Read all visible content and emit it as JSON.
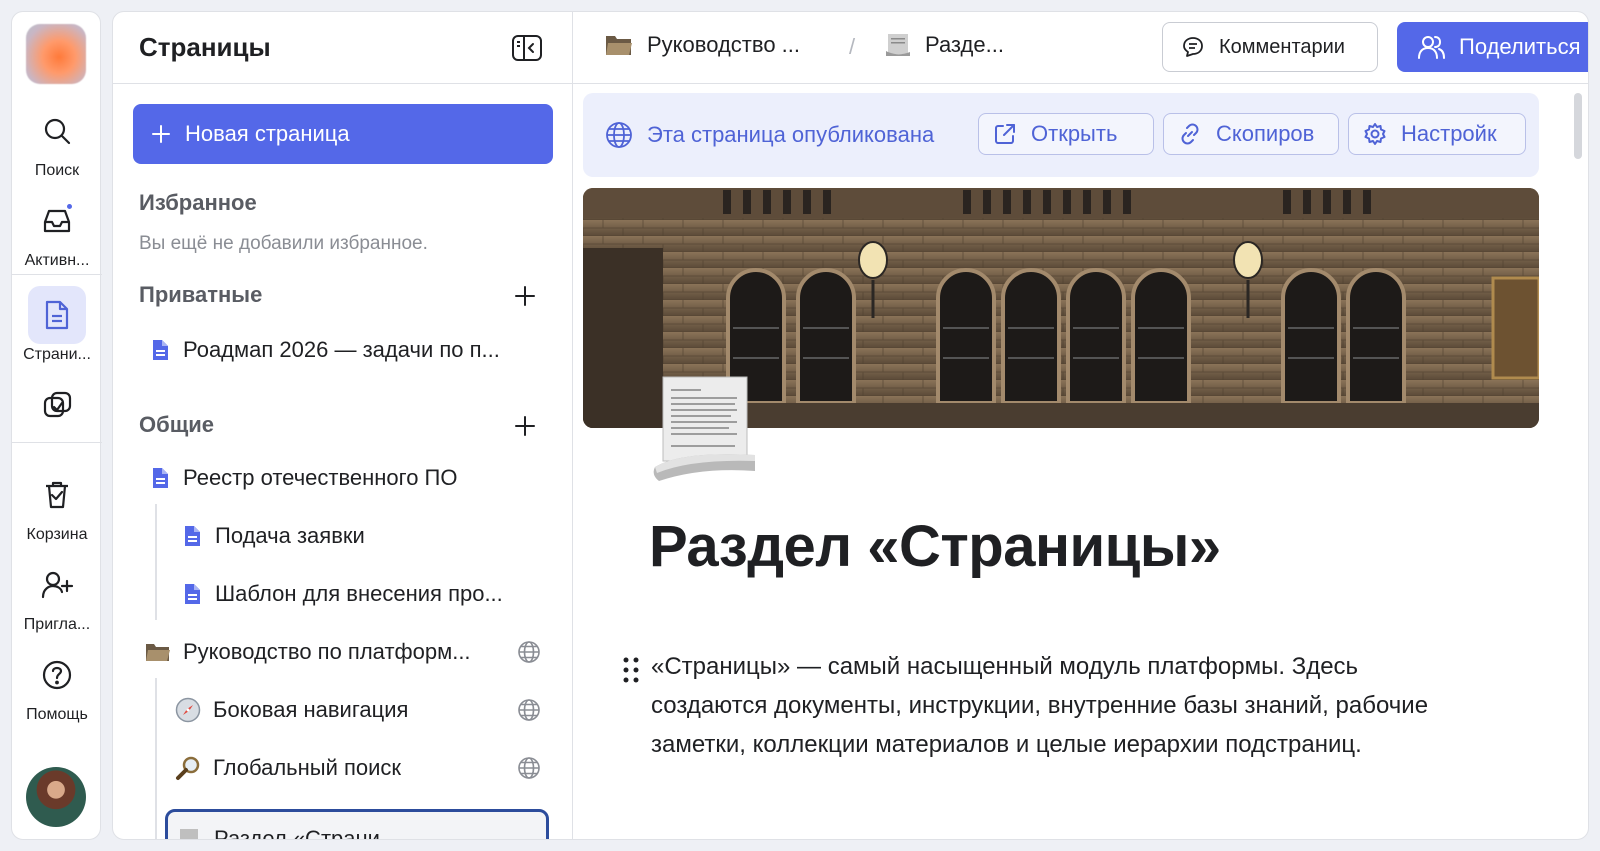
{
  "rail": {
    "items": [
      {
        "label": "Поиск",
        "icon": "search-icon"
      },
      {
        "label": "Активн...",
        "icon": "inbox-icon"
      },
      {
        "label": "Страни...",
        "icon": "pages-icon"
      },
      {
        "label": "",
        "icon": "tasks-icon"
      },
      {
        "label": "Корзина",
        "icon": "trash-icon"
      },
      {
        "label": "Пригла...",
        "icon": "invite-icon"
      },
      {
        "label": "Помощь",
        "icon": "help-icon"
      }
    ]
  },
  "sidebar": {
    "title": "Страницы",
    "new_page_label": "Новая страница",
    "favorites": {
      "title": "Избранное",
      "empty_note": "Вы ещё не добавили избранное."
    },
    "private": {
      "title": "Приватные",
      "items": [
        "Роадмап 2026 — задачи по п..."
      ]
    },
    "shared": {
      "title": "Общие",
      "items": [
        {
          "label": "Реестр отечественного ПО",
          "icon": "doc-icon"
        },
        {
          "label": "Подача заявки",
          "icon": "doc-icon"
        },
        {
          "label": "Шаблон для внесения про...",
          "icon": "doc-icon"
        },
        {
          "label": "Руководство по платформ...",
          "icon": "folder-icon"
        },
        {
          "label": "Боковая навигация",
          "icon": "compass-icon"
        },
        {
          "label": "Глобальный поиск",
          "icon": "magnifier-icon"
        },
        {
          "label": "Раздел «Страни...",
          "icon": "scroll-icon"
        }
      ]
    }
  },
  "topbar": {
    "breadcrumbs": [
      "Руководство ...",
      "Разде..."
    ],
    "separator": "/",
    "comments_label": "Комментарии",
    "share_label": "Поделиться"
  },
  "publish": {
    "status": "Эта страница опубликована",
    "open_label": "Открыть",
    "copy_label": "Скопиров",
    "settings_label": "Настройк"
  },
  "page": {
    "title": "Раздел «Страницы»",
    "paragraph": "«Страницы» — самый насыщенный модуль платформы. Здесь создаются документы, инструкции, внутренние базы знаний, рабочие заметки, коллекции материалов и целые иерархии подстраниц."
  },
  "colors": {
    "accent": "#5468e8",
    "publish_bg": "#eceffc",
    "publish_text": "#4f63d6"
  }
}
